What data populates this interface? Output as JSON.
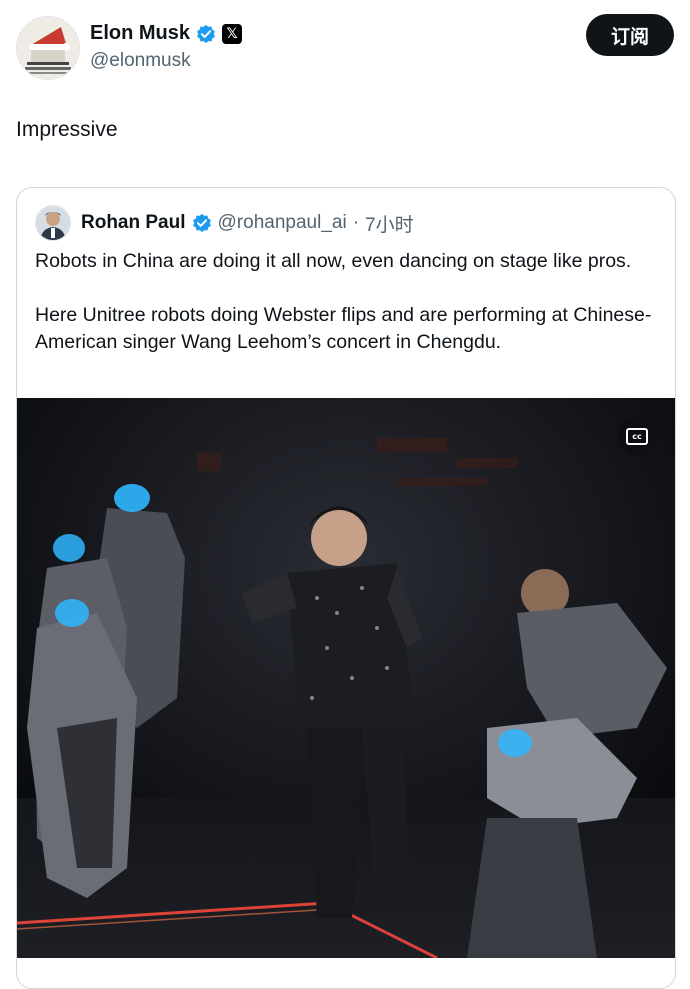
{
  "post": {
    "author": {
      "display_name": "Elon Musk",
      "handle": "@elonmusk",
      "x_badge": "𝕏",
      "verified_icon": "verified-badge-icon"
    },
    "subscribe_label": "订阅",
    "text": "Impressive"
  },
  "quoted": {
    "author": {
      "display_name": "Rohan Paul",
      "handle": "@rohanpaul_ai",
      "separator": "·",
      "time": "7小时"
    },
    "paragraphs": [
      "Robots in China are doing it all now, even dancing on stage like pros.",
      "Here Unitree robots doing Webster flips and are performing at Chinese-American singer Wang Leehom’s concert in Chengdu."
    ],
    "media": {
      "cc_label": "cc"
    }
  },
  "colors": {
    "verified_blue": "#1d9bf0",
    "text_primary": "#0f1419",
    "text_secondary": "#536471",
    "robot_visor": "#2fb7ff",
    "stage_line": "#ff4a3a"
  }
}
